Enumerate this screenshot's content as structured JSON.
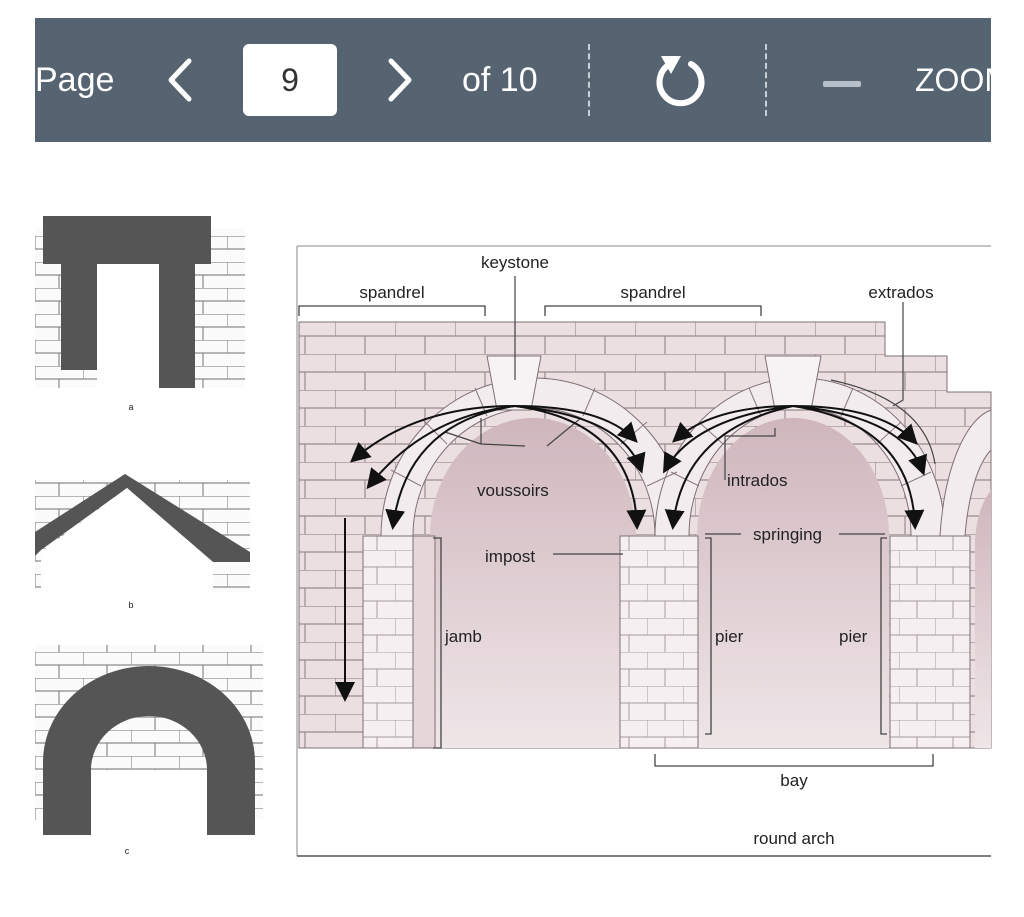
{
  "toolbar": {
    "page_label": "Page",
    "page_number": "9",
    "of_label": "of 10",
    "zoom_label": "ZOOM",
    "icons": [
      "chevron-left-icon",
      "chevron-right-icon",
      "rotate-icon",
      "zoom-out-icon"
    ]
  },
  "figure": {
    "panel_labels": [
      "a",
      "b",
      "c"
    ],
    "labels": {
      "keystone": "keystone",
      "spandrel_left": "spandrel",
      "spandrel_right": "spandrel",
      "extrados": "extrados",
      "voussoirs": "voussoirs",
      "intrados": "intrados",
      "springing": "springing",
      "impost": "impost",
      "jamb": "jamb",
      "pier_left": "pier",
      "pier_right": "pier",
      "bay": "bay",
      "caption": "round arch"
    }
  }
}
